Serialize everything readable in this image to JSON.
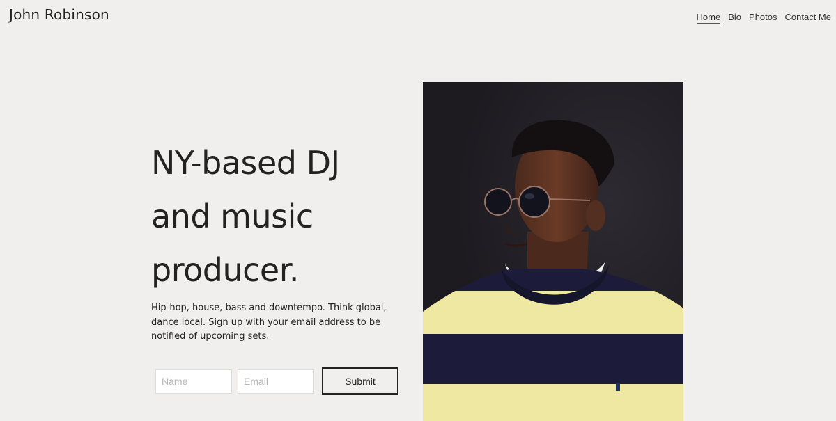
{
  "header": {
    "site_title": "John Robinson",
    "nav": [
      {
        "label": "Home",
        "active": true
      },
      {
        "label": "Bio",
        "active": false
      },
      {
        "label": "Photos",
        "active": false
      },
      {
        "label": "Contact Me",
        "active": false
      }
    ]
  },
  "hero": {
    "heading_lines": [
      "NY-based DJ",
      "and music",
      "producer."
    ],
    "description": "Hip-hop, house, bass and downtempo. Think global, dance local. Sign up with your email address to be notified of upcoming sets."
  },
  "form": {
    "name_placeholder": "Name",
    "email_placeholder": "Email",
    "submit_label": "Submit"
  },
  "colors": {
    "background": "#f0efee",
    "text": "#222222",
    "photo_background": "#221e25",
    "sweater_yellow": "#efe8a2",
    "sweater_navy": "#1c1c3a"
  },
  "image": {
    "subject": "portrait-photo"
  }
}
